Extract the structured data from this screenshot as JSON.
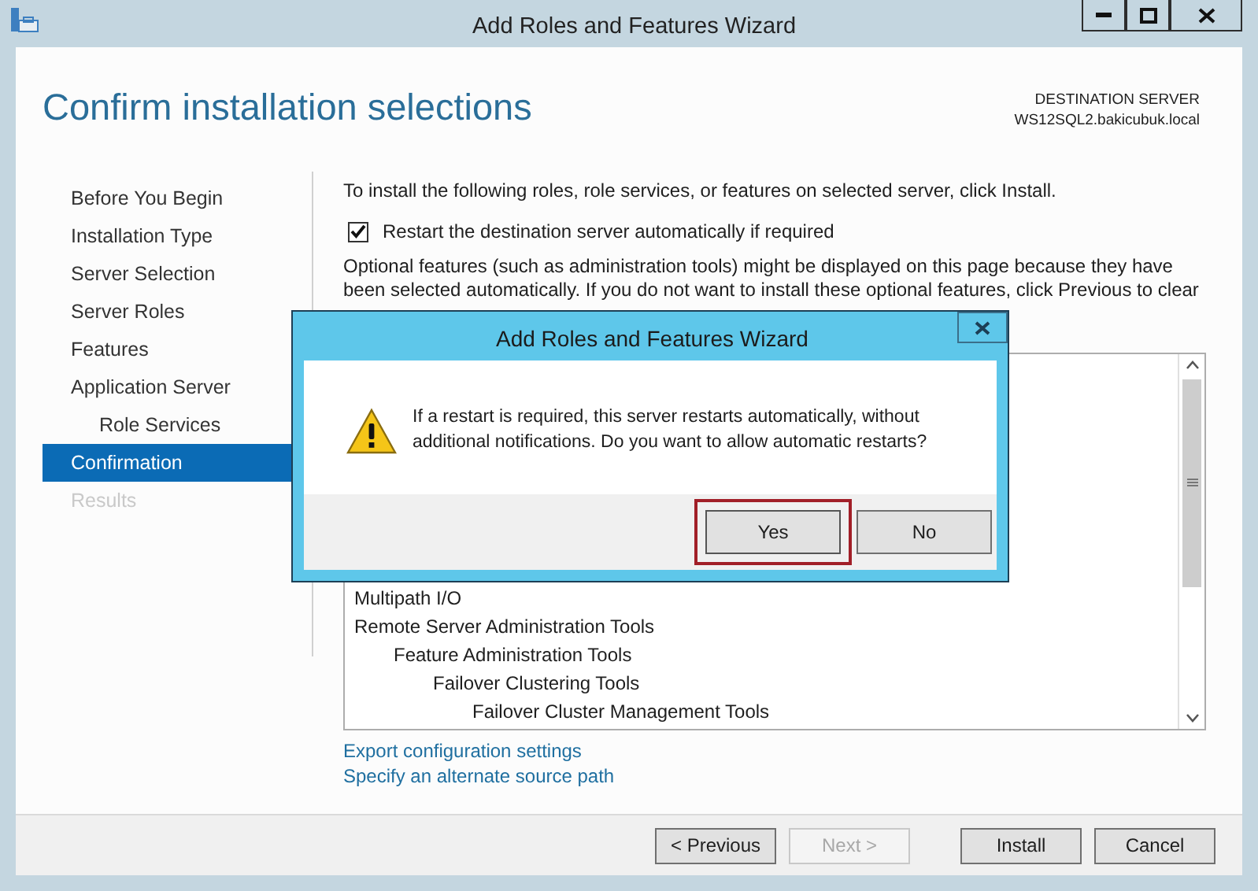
{
  "window": {
    "title": "Add Roles and Features Wizard"
  },
  "header": {
    "title": "Confirm installation selections",
    "destination_label": "DESTINATION SERVER",
    "destination_server": "WS12SQL2.bakicubuk.local"
  },
  "nav": {
    "items": [
      {
        "label": "Before You Begin",
        "selected": false,
        "disabled": false
      },
      {
        "label": "Installation Type",
        "selected": false,
        "disabled": false
      },
      {
        "label": "Server Selection",
        "selected": false,
        "disabled": false
      },
      {
        "label": "Server Roles",
        "selected": false,
        "disabled": false
      },
      {
        "label": "Features",
        "selected": false,
        "disabled": false
      },
      {
        "label": "Application Server",
        "selected": false,
        "disabled": false,
        "children": [
          {
            "label": "Role Services",
            "selected": false,
            "disabled": false
          }
        ]
      },
      {
        "label": "Confirmation",
        "selected": true,
        "disabled": false
      },
      {
        "label": "Results",
        "selected": false,
        "disabled": true
      }
    ]
  },
  "content": {
    "intro": "To install the following roles, role services, or features on selected server, click Install.",
    "restart_option": {
      "label": "Restart the destination server automatically if required",
      "checked": true
    },
    "note": "Optional features (such as administration tools) might be displayed on this page because they have been selected automatically. If you do not want to install these optional features, click Previous to clear",
    "features": [
      {
        "label": "Multipath I/O"
      },
      {
        "label": "Remote Server Administration Tools",
        "children": [
          {
            "label": "Feature Administration Tools",
            "children": [
              {
                "label": "Failover Clustering Tools",
                "children": [
                  {
                    "label": "Failover Cluster Management Tools"
                  }
                ]
              }
            ]
          }
        ]
      }
    ],
    "links": [
      "Export configuration settings",
      "Specify an alternate source path"
    ]
  },
  "footer": {
    "buttons": [
      {
        "label": "< Previous",
        "disabled": false
      },
      {
        "label": "Next >",
        "disabled": true
      },
      {
        "label": "Install",
        "disabled": false
      },
      {
        "label": "Cancel",
        "disabled": false
      }
    ]
  },
  "dialog": {
    "title": "Add Roles and Features Wizard",
    "message": "If a restart is required, this server restarts automatically, without additional notifications. Do you want to allow automatic restarts?",
    "buttons": [
      {
        "label": "Yes",
        "focused": true
      },
      {
        "label": "No",
        "focused": false
      }
    ]
  }
}
